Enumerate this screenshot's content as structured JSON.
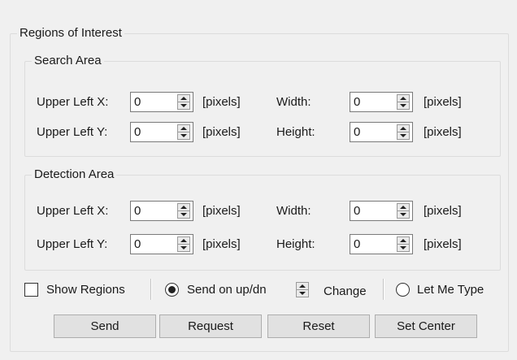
{
  "roi": {
    "title": "Regions of Interest",
    "search": {
      "title": "Search Area",
      "upper_left_x_label": "Upper Left X:",
      "upper_left_x_value": "0",
      "upper_left_y_label": "Upper Left Y:",
      "upper_left_y_value": "0",
      "width_label": "Width:",
      "width_value": "0",
      "height_label": "Height:",
      "height_value": "0",
      "unit": "[pixels]"
    },
    "detection": {
      "title": "Detection Area",
      "upper_left_x_label": "Upper Left X:",
      "upper_left_x_value": "0",
      "upper_left_y_label": "Upper Left Y:",
      "upper_left_y_value": "0",
      "width_label": "Width:",
      "width_value": "0",
      "height_label": "Height:",
      "height_value": "0",
      "unit": "[pixels]"
    },
    "options": {
      "show_regions_label": "Show Regions",
      "show_regions_checked": false,
      "send_on_updn_label": "Send on up/dn",
      "change_label": "Change",
      "let_me_type_label": "Let Me Type",
      "selected_mode": "Send on up/dn"
    },
    "buttons": {
      "send": "Send",
      "request": "Request",
      "reset": "Reset",
      "set_center": "Set Center"
    }
  }
}
